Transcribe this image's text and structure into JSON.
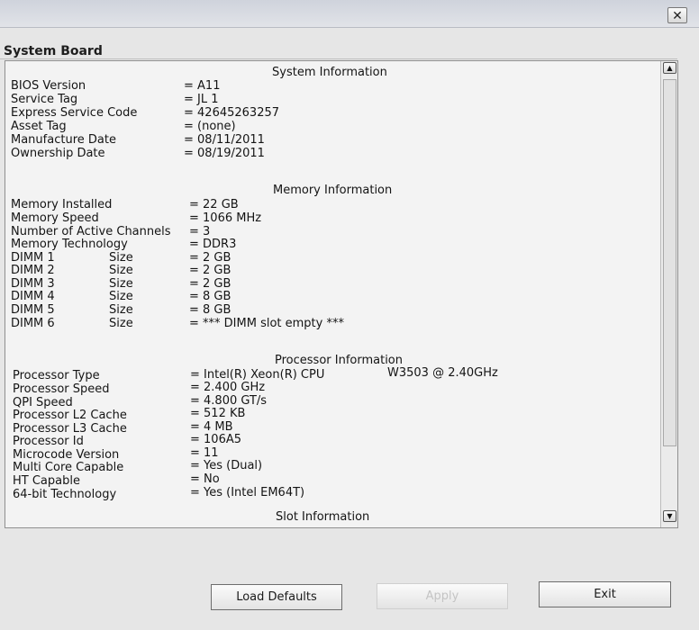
{
  "window": {
    "close_glyph": "✕"
  },
  "page": {
    "title": "System Board"
  },
  "sections": {
    "system_heading": "System Information",
    "memory_heading": "Memory Information",
    "processor_heading": "Processor Information",
    "slot_heading": "Slot Information"
  },
  "system_rows": [
    {
      "label": "BIOS Version",
      "value": "= A11"
    },
    {
      "label": "Service Tag",
      "value": "= JL        1"
    },
    {
      "label": "Express Service Code",
      "value": "= 42645263257"
    },
    {
      "label": "Asset Tag",
      "value": "= (none)"
    },
    {
      "label": "Manufacture Date",
      "value": "= 08/11/2011"
    },
    {
      "label": "Ownership Date",
      "value": "= 08/19/2011"
    }
  ],
  "memory_rows": [
    {
      "label": "Memory Installed",
      "value": "= 22 GB"
    },
    {
      "label": "Memory Speed",
      "value": "= 1066 MHz"
    },
    {
      "label": "Number of Active Channels",
      "value": "= 3"
    },
    {
      "label": "Memory Technology",
      "value": "= DDR3"
    }
  ],
  "dimm_rows": [
    {
      "label": "DIMM 1",
      "sub": "Size",
      "value": "= 2 GB"
    },
    {
      "label": "DIMM 2",
      "sub": "Size",
      "value": "= 2 GB"
    },
    {
      "label": "DIMM 3",
      "sub": "Size",
      "value": "= 2 GB"
    },
    {
      "label": "DIMM 4",
      "sub": "Size",
      "value": "= 8 GB"
    },
    {
      "label": "DIMM 5",
      "sub": "Size",
      "value": "= 8 GB"
    },
    {
      "label": "DIMM 6",
      "sub": "Size",
      "value": "= *** DIMM slot empty ***"
    }
  ],
  "processor_rows": [
    {
      "label": "Processor Type",
      "value": "= Intel(R) Xeon(R) CPU",
      "extra": "W3503  @ 2.40GHz"
    },
    {
      "label": "Processor Speed",
      "value": "= 2.400 GHz"
    },
    {
      "label": "QPI Speed",
      "value": "= 4.800 GT/s"
    },
    {
      "label": "Processor L2 Cache",
      "value": "= 512 KB"
    },
    {
      "label": "Processor L3 Cache",
      "value": "= 4 MB"
    },
    {
      "label": "Processor Id",
      "value": "= 106A5"
    },
    {
      "label": "Microcode Version",
      "value": "= 11"
    },
    {
      "label": "Multi Core Capable",
      "value": "= Yes (Dual)"
    },
    {
      "label": "HT Capable",
      "value": "= No"
    },
    {
      "label": "64-bit Technology",
      "value": "= Yes (Intel EM64T)"
    }
  ],
  "scrollbar": {
    "up_glyph": "▲",
    "down_glyph": "▼"
  },
  "footer": {
    "load_defaults": "Load Defaults",
    "apply": "Apply",
    "exit": "Exit"
  }
}
